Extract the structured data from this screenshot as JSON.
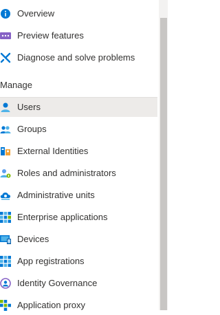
{
  "menu": {
    "top_items": [
      {
        "label": "Overview",
        "icon": "info-icon"
      },
      {
        "label": "Preview features",
        "icon": "preview-features-icon"
      },
      {
        "label": "Diagnose and solve problems",
        "icon": "wrench-icon"
      }
    ],
    "section_header": "Manage",
    "manage_items": [
      {
        "label": "Users",
        "icon": "user-icon",
        "selected": true
      },
      {
        "label": "Groups",
        "icon": "groups-icon"
      },
      {
        "label": "External Identities",
        "icon": "external-identities-icon"
      },
      {
        "label": "Roles and administrators",
        "icon": "roles-icon"
      },
      {
        "label": "Administrative units",
        "icon": "administrative-units-icon"
      },
      {
        "label": "Enterprise applications",
        "icon": "enterprise-apps-icon"
      },
      {
        "label": "Devices",
        "icon": "devices-icon"
      },
      {
        "label": "App registrations",
        "icon": "app-registrations-icon"
      },
      {
        "label": "Identity Governance",
        "icon": "identity-governance-icon"
      },
      {
        "label": "Application proxy",
        "icon": "application-proxy-icon"
      }
    ]
  },
  "colors": {
    "selected_background": "#edebe9",
    "accent_blue": "#0078d4"
  }
}
